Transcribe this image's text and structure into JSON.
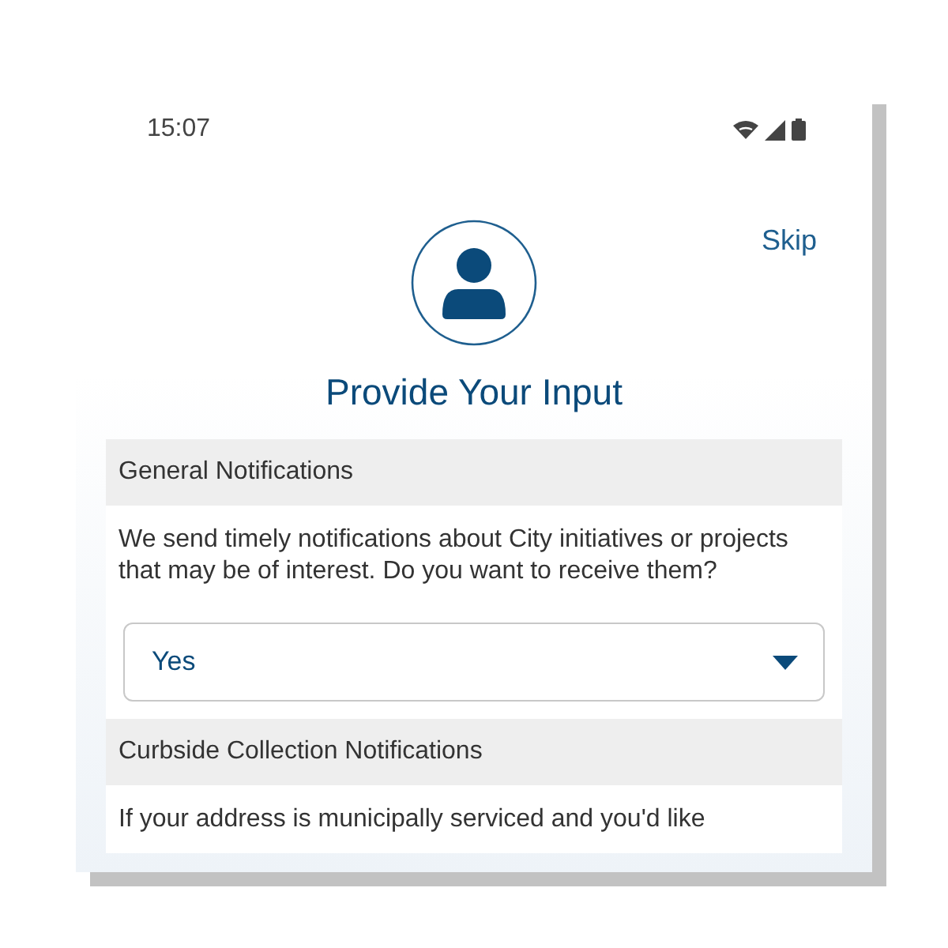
{
  "status_bar": {
    "time": "15:07"
  },
  "skip": "Skip",
  "title": "Provide Your Input",
  "sections": [
    {
      "heading": "General Notifications",
      "text": "We send timely notifications about City initiatives or projects that may be of interest. Do you want to receive them?",
      "dropdown": {
        "value": "Yes"
      }
    },
    {
      "heading": "Curbside Collection Notifications",
      "text": "If your address is municipally serviced and you'd like"
    }
  ]
}
